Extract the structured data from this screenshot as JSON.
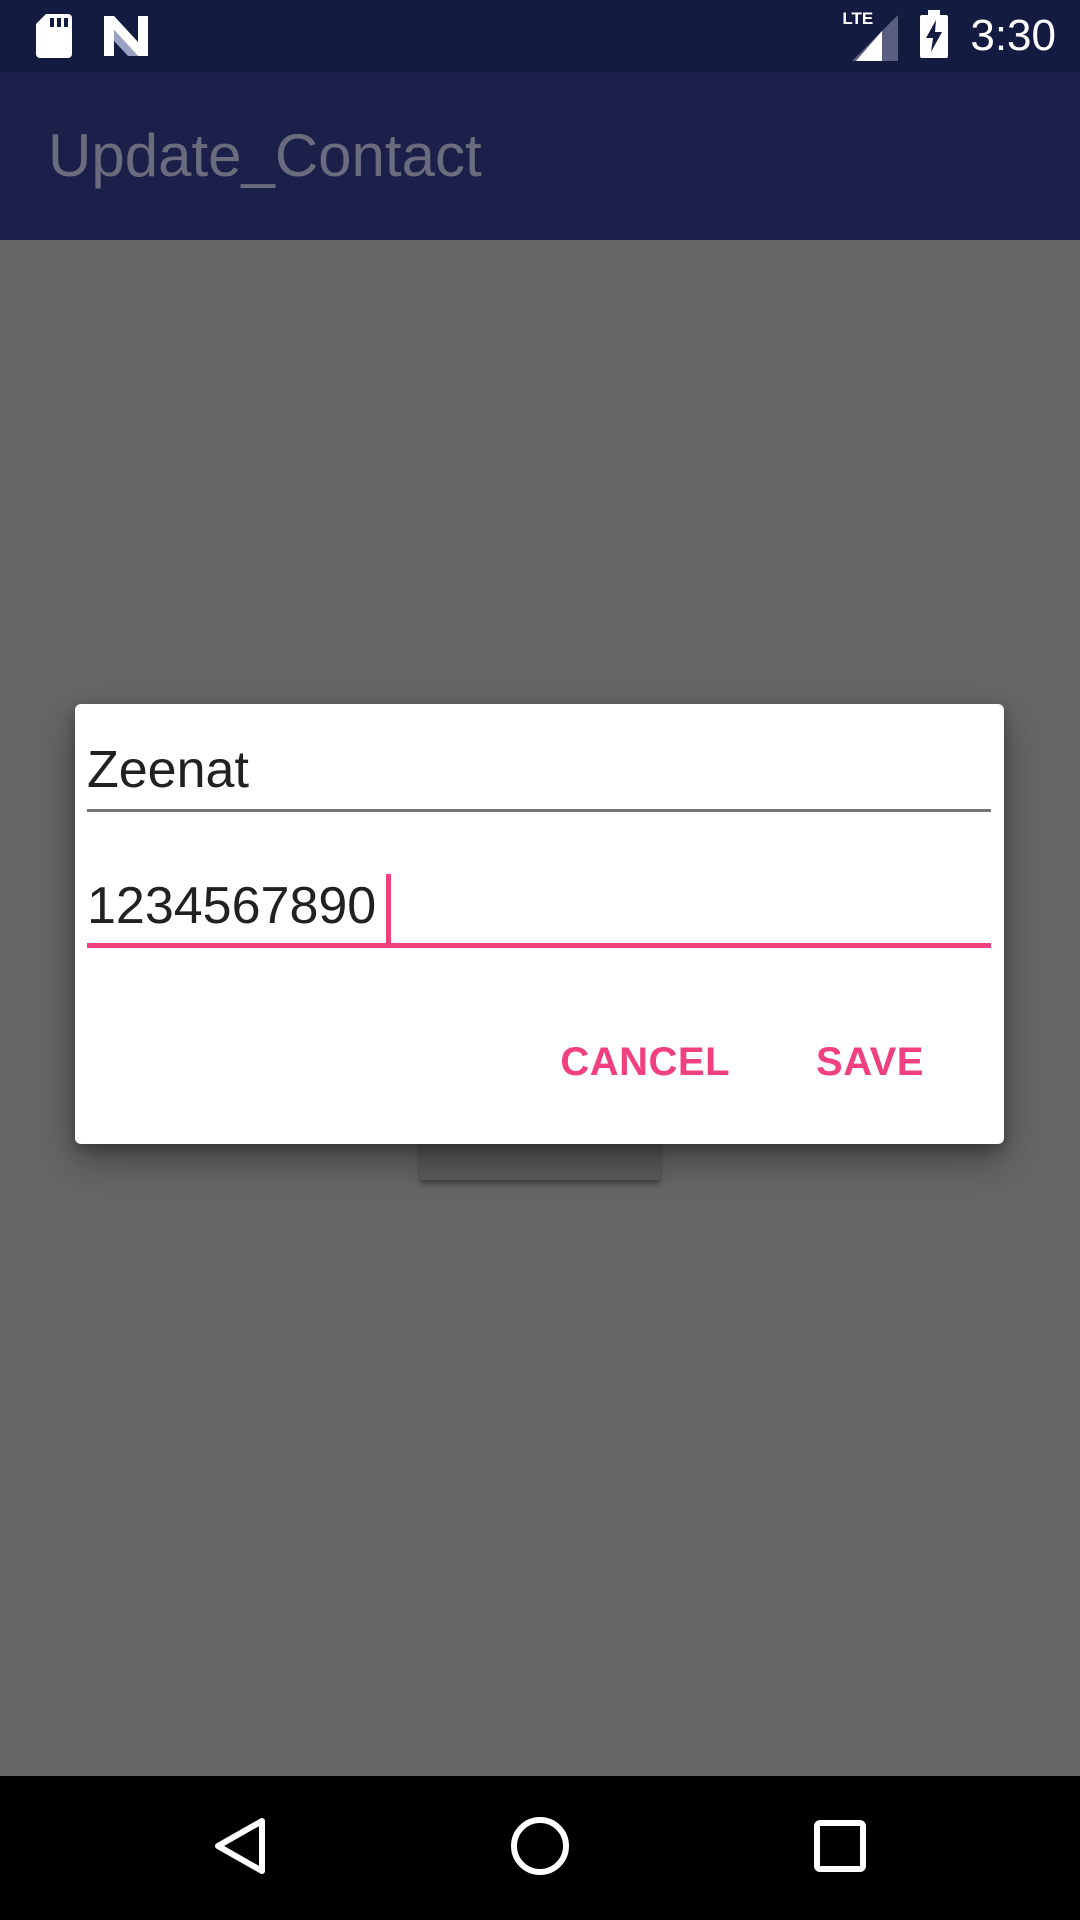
{
  "status_bar": {
    "time": "3:30",
    "network_label": "LTE",
    "left_icons": [
      "sd-card-icon",
      "n-logo-icon"
    ],
    "right_icons": [
      "lte-signal-icon",
      "battery-charging-icon"
    ]
  },
  "app_bar": {
    "title": "Update_Contact"
  },
  "dialog": {
    "name_value": "Zeenat",
    "phone_value": "1234567890",
    "cancel_label": "CANCEL",
    "save_label": "SAVE"
  },
  "nav_bar": {
    "icons": [
      "back-icon",
      "home-icon",
      "recents-icon"
    ]
  },
  "colors": {
    "status_bar": "#141b40",
    "app_bar": "#1a2049",
    "accent": "#f0407f",
    "scrim": "#666666"
  }
}
